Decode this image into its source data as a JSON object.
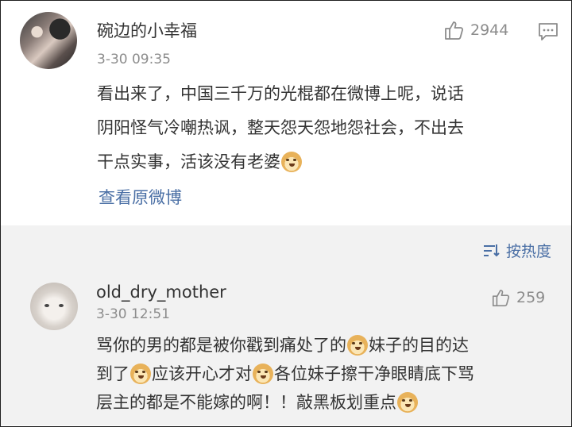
{
  "post": {
    "author": "碗边的小幸福",
    "time": "3-30 09:35",
    "like_count": "2944",
    "lines": [
      "看出来了，中国三千万的光棍都在微博上呢，说话",
      "阴阳怪气冷嘲热讽，整天怨天怨地怨社会，不出去",
      "干点实事，活该没有老婆"
    ],
    "view_original": "查看原微博"
  },
  "sort": {
    "label": "按热度"
  },
  "comment": {
    "author": "old_dry_mother",
    "time": "3-30 12:51",
    "like_count": "259",
    "segments": {
      "l1a": "骂你的男的都是被你戳到痛处了的",
      "l1b": "妹子的目的达",
      "l2a": "到了",
      "l2b": "应该开心才对",
      "l2c": "各位妹子擦干净眼睛底下骂",
      "l3a": "层主的都是不能嫁的啊！！敲黑板划重点"
    }
  },
  "icons": {
    "like": "thumbs-up-icon",
    "comment": "comment-icon",
    "sort": "sort-icon",
    "emoji": "doge-emoji-icon"
  },
  "colors": {
    "link": "#4a6fa5",
    "secondary_text": "#8c8c8c",
    "comment_bg": "#f2f2f2"
  }
}
